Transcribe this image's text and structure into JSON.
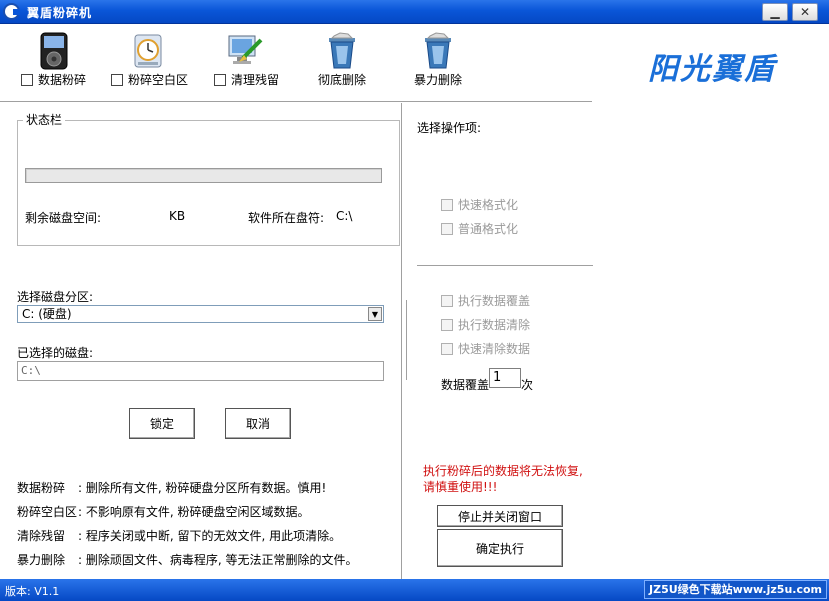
{
  "window": {
    "title": "翼盾粉碎机",
    "minimize_glyph": "▁",
    "close_glyph": "✕"
  },
  "toolbar": {
    "items": [
      {
        "label": "数据粉碎",
        "icon": "ipod-icon",
        "checkbox": true
      },
      {
        "label": "粉碎空白区",
        "icon": "clock-icon",
        "checkbox": true
      },
      {
        "label": "清理残留",
        "icon": "monitor-brush-icon",
        "checkbox": true
      },
      {
        "label": "彻底删除",
        "icon": "recycle-bin-icon",
        "checkbox": false
      },
      {
        "label": "暴力删除",
        "icon": "recycle-bin-icon",
        "checkbox": false
      }
    ]
  },
  "brand": "阳光翼盾",
  "status_group": {
    "title": "状态栏",
    "free_space_label": "剩余磁盘空间:",
    "free_space_unit": "KB",
    "drive_label": "软件所在盘符:",
    "drive_value": "C:\\"
  },
  "disk_select": {
    "label": "选择磁盘分区:",
    "selected": "C: (硬盘)",
    "chosen_label": "已选择的磁盘:",
    "chosen_value": "C:\\"
  },
  "buttons": {
    "lock": "锁定",
    "cancel": "取消",
    "stop_close": "停止并关闭窗口",
    "execute": "确定执行"
  },
  "options": {
    "title": "选择操作项:",
    "format": [
      "快速格式化",
      "普通格式化"
    ],
    "data_ops": [
      "执行数据覆盖",
      "执行数据清除",
      "快速清除数据"
    ],
    "overwrite_label": "数据覆盖",
    "overwrite_count": "1",
    "overwrite_unit": "次"
  },
  "warning": "执行粉碎后的数据将无法恢复, 请慎重使用!!!",
  "descriptions": [
    {
      "key": "数据粉碎",
      "text": ": 删除所有文件, 粉碎硬盘分区所有数据。慎用!"
    },
    {
      "key": "粉碎空白区",
      "text": ": 不影响原有文件, 粉碎硬盘空闲区域数据。"
    },
    {
      "key": "清除残留",
      "text": ": 程序关闭或中断, 留下的无效文件, 用此项清除。"
    },
    {
      "key": "暴力删除",
      "text": ": 删除顽固文件、病毒程序, 等无法正常删除的文件。"
    }
  ],
  "statusbar": {
    "version": "版本: V1.1",
    "watermark": "JZ5U绿色下载站www.jz5u.com"
  }
}
